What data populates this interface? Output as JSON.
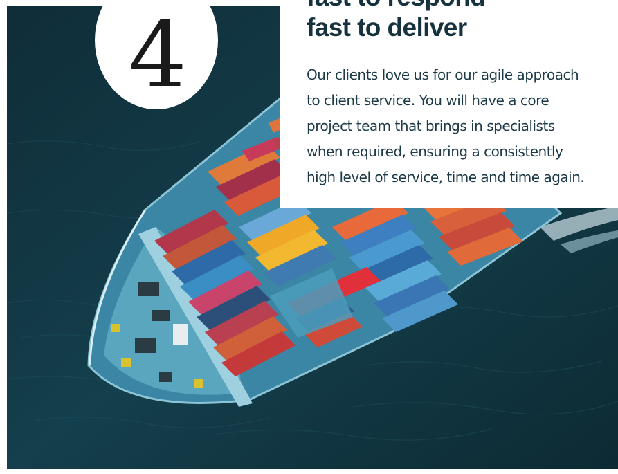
{
  "feature": {
    "step_number": "4",
    "heading_line_1": "fast to respond",
    "heading_line_2": "fast to deliver",
    "body_lines": [
      "Our clients love us for our agile approach",
      "to client service. You will have a core",
      "project team that brings in specialists",
      "when required, ensuring a consistently",
      "high level of service, time and time again."
    ]
  },
  "colors": {
    "heading": "#16323f",
    "body_text": "#1c3a47",
    "sea": "#123a46",
    "hull": "#3d8aa8"
  },
  "image": {
    "subject": "aerial-view-of-container-ship-at-sea"
  }
}
